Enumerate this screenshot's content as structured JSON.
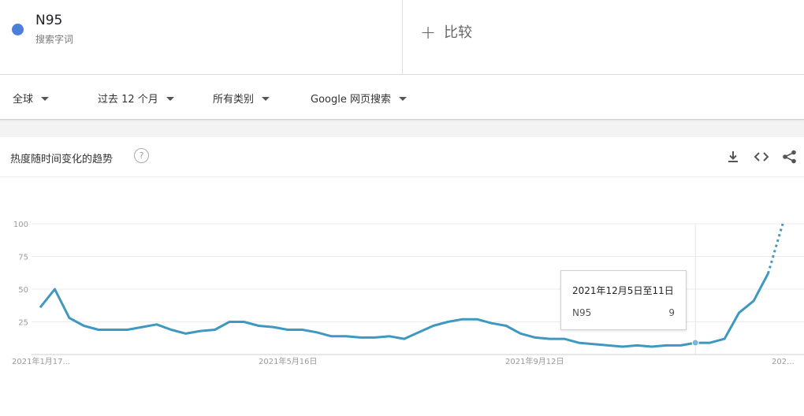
{
  "search_term": {
    "name": "N95",
    "subtitle": "搜索字词",
    "color": "#4a7fdc"
  },
  "compare": {
    "label": "比较"
  },
  "filters": {
    "region": "全球",
    "time": "过去 12 个月",
    "category": "所有类别",
    "source": "Google 网页搜索"
  },
  "card": {
    "title": "热度随时间变化的趋势",
    "help_glyph": "?"
  },
  "tooltip": {
    "date": "2021年12月5日至11日",
    "term": "N95",
    "value": "9"
  },
  "chart_data": {
    "type": "line",
    "x_tick_labels": [
      "2021年1月17...",
      "2021年5月16日",
      "2021年9月12日",
      "202..."
    ],
    "y_tick_labels": [
      "100",
      "75",
      "50",
      "25"
    ],
    "ylim": [
      0,
      100
    ],
    "line_color": "#3f98c0",
    "series": [
      {
        "values": [
          36,
          50,
          28,
          22,
          19,
          19,
          19,
          21,
          23,
          19,
          16,
          18,
          19,
          25,
          25,
          22,
          21,
          19,
          19,
          17,
          14,
          14,
          13,
          13,
          14,
          12,
          17,
          22,
          25,
          27,
          27,
          24,
          22,
          16,
          13,
          12,
          12,
          9,
          8,
          7,
          6,
          7,
          6,
          7,
          7,
          9,
          9,
          12,
          32,
          41,
          62,
          100
        ],
        "dotted_from_index": 50,
        "highlight_index": 45
      }
    ]
  }
}
